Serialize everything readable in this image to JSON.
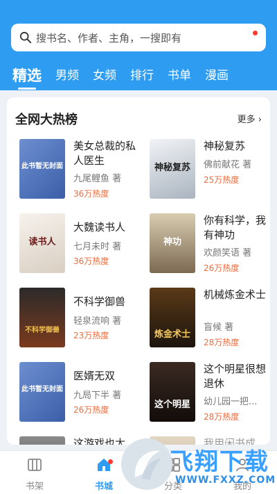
{
  "search": {
    "placeholder": "搜书名、作者、主角，一搜即有"
  },
  "tabs": [
    {
      "label": "精选",
      "active": true
    },
    {
      "label": "男频"
    },
    {
      "label": "女频"
    },
    {
      "label": "排行"
    },
    {
      "label": "书单"
    },
    {
      "label": "漫画"
    }
  ],
  "section": {
    "title": "全网大热榜",
    "more": "更多"
  },
  "books": [
    {
      "title": "美女总裁的私人医生",
      "author": "九尾鲤鱼 著",
      "heat": "36万热度",
      "cover_text": "此书暂无封面",
      "cover_color": "#4a6fb3"
    },
    {
      "title": "神秘复苏",
      "author": "佛前献花 著",
      "heat": "25万热度",
      "cover_text": "神秘复苏",
      "cover_color": "#d9dde3"
    },
    {
      "title": "大魏读书人",
      "author": "七月未时 著",
      "heat": "36万热度",
      "cover_text": "读书人",
      "cover_color": "#ece6de"
    },
    {
      "title": "你有科学，我有神功",
      "author": "欢颜笑语 著",
      "heat": "26万热度",
      "cover_text": "神功",
      "cover_color": "#b9a887"
    },
    {
      "title": "不科学御兽",
      "author": "轻泉流响 著",
      "heat": "23万热度",
      "cover_text": "不科学御兽",
      "cover_color": "#3a2a22"
    },
    {
      "title": "机械炼金术士",
      "author": "盲候 著",
      "heat": "28万热度",
      "cover_text": "炼金术士",
      "cover_color": "#2a2219"
    },
    {
      "title": "医婿无双",
      "author": "九局下半 著",
      "heat": "26万热度",
      "cover_text": "此书暂无封面",
      "cover_color": "#4a6fb3"
    },
    {
      "title": "这个明星很想退休",
      "author": "幼儿园一把...",
      "heat": "28万热度",
      "cover_text": "这个明星",
      "cover_color": "#2a1d18"
    },
    {
      "title": "这游戏也太",
      "author": "",
      "heat": "",
      "cover_text": "",
      "cover_color": "#6b6b6b"
    },
    {
      "title": "我用闲书成",
      "author": "",
      "heat": "",
      "cover_text": "",
      "cover_color": "#d8c9b4"
    }
  ],
  "bottom_nav": [
    {
      "label": "书架",
      "icon": "bookshelf-icon"
    },
    {
      "label": "书城",
      "icon": "home-icon",
      "active": true
    },
    {
      "label": "分类",
      "icon": "category-icon"
    },
    {
      "label": "我的",
      "icon": "profile-icon"
    }
  ],
  "watermark": {
    "title": "飞翔下载",
    "url": "WWW.FXXZ.COM"
  },
  "colors": {
    "primary": "#2e9cf0",
    "heat": "#f06a3b",
    "badge": "#ff3b30"
  }
}
